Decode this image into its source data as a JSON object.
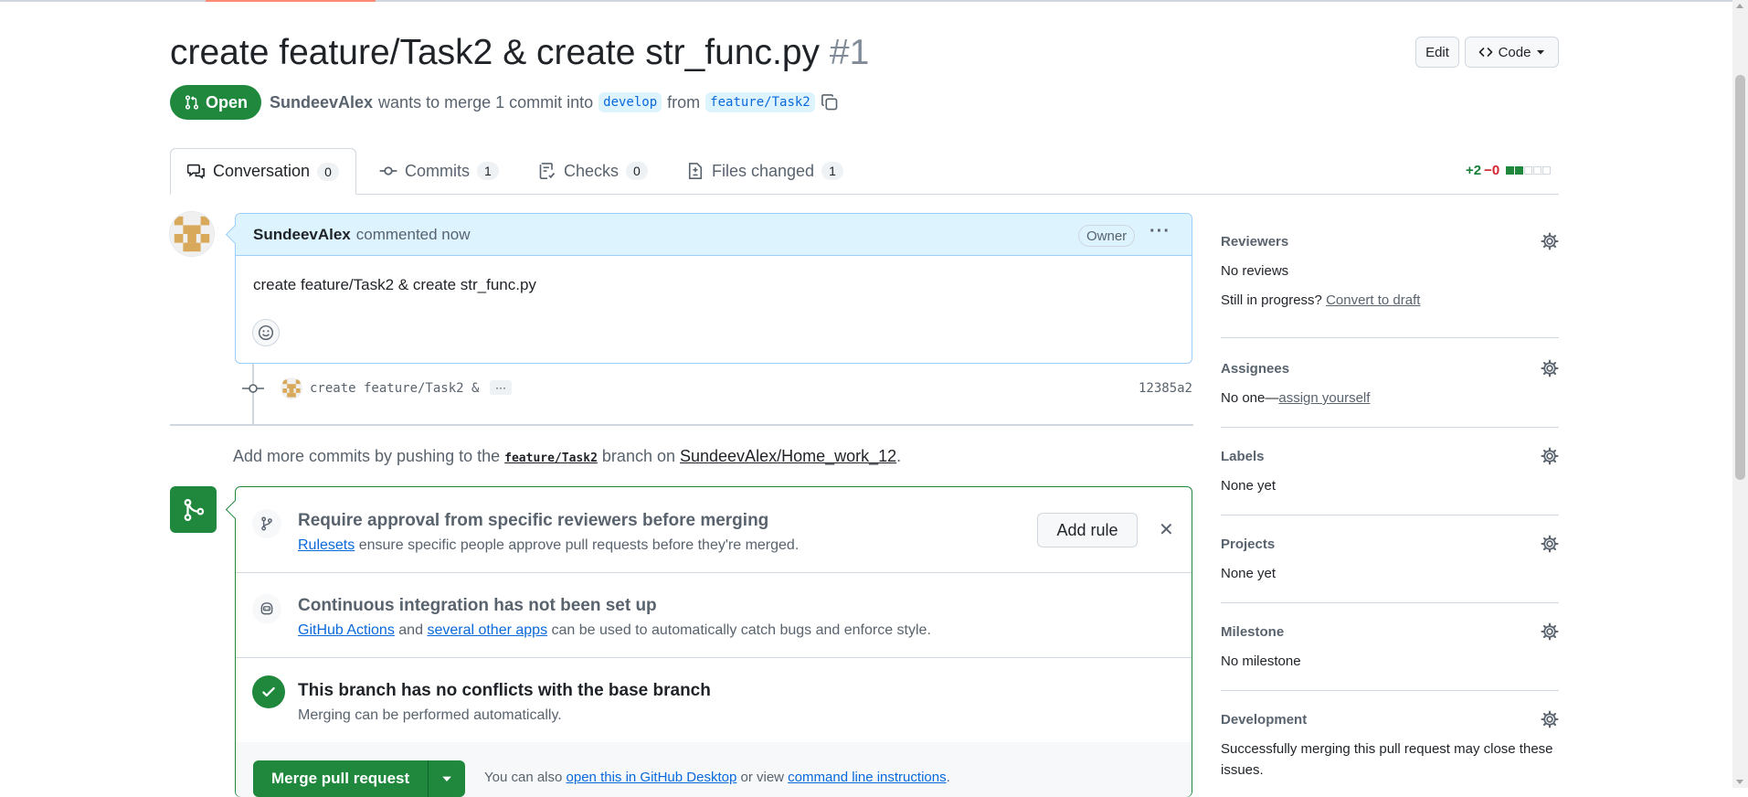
{
  "pr": {
    "title": "create feature/Task2 & create str_func.py",
    "number": "#1",
    "state": "Open",
    "author": "SundeevAlex",
    "merge_text": "wants to merge 1 commit into",
    "base_branch": "develop",
    "from_text": "from",
    "head_branch": "feature/Task2"
  },
  "header_buttons": {
    "edit": "Edit",
    "code": "Code"
  },
  "tabs": [
    {
      "label": "Conversation",
      "count": "0"
    },
    {
      "label": "Commits",
      "count": "1"
    },
    {
      "label": "Checks",
      "count": "0"
    },
    {
      "label": "Files changed",
      "count": "1"
    }
  ],
  "diffstat": {
    "additions": "+2",
    "deletions": "−0",
    "filled_blocks": 2,
    "total_blocks": 5
  },
  "comment": {
    "author": "SundeevAlex",
    "action": "commented now",
    "role": "Owner",
    "body": "create feature/Task2 & create str_func.py",
    "menu": "···"
  },
  "commit": {
    "message": "create feature/Task2 &",
    "more": "···",
    "sha": "12385a2"
  },
  "push_hint": {
    "prefix": "Add more commits by pushing to the",
    "branch": "feature/Task2",
    "middle": "branch on",
    "repo": "SundeevAlex/Home_work_12",
    "suffix": "."
  },
  "merge_box": {
    "rules": {
      "title": "Require approval from specific reviewers before merging",
      "link": "Rulesets",
      "text": "ensure specific people approve pull requests before they're merged.",
      "button": "Add rule",
      "close": "✕"
    },
    "ci": {
      "title": "Continuous integration has not been set up",
      "link1": "GitHub Actions",
      "and": "and",
      "link2": "several other apps",
      "text": "can be used to automatically catch bugs and enforce style."
    },
    "conflicts": {
      "title": "This branch has no conflicts with the base branch",
      "text": "Merging can be performed automatically."
    },
    "merge_button": "Merge pull request",
    "footer": {
      "prefix": "You can also",
      "link1": "open this in GitHub Desktop",
      "middle": "or view",
      "link2": "command line instructions",
      "suffix": "."
    }
  },
  "sidebar": {
    "reviewers": {
      "title": "Reviewers",
      "value": "No reviews",
      "progress": "Still in progress?",
      "progress_link": "Convert to draft"
    },
    "assignees": {
      "title": "Assignees",
      "value": "No one—",
      "link": "assign yourself"
    },
    "labels": {
      "title": "Labels",
      "value": "None yet"
    },
    "projects": {
      "title": "Projects",
      "value": "None yet"
    },
    "milestone": {
      "title": "Milestone",
      "value": "No milestone"
    },
    "development": {
      "title": "Development",
      "value": "Successfully merging this pull request may close these",
      "value2": "issues."
    }
  },
  "colors": {
    "accent_green": "#1f883d",
    "link_blue": "#0969da",
    "comment_bg": "#ddf4ff"
  }
}
